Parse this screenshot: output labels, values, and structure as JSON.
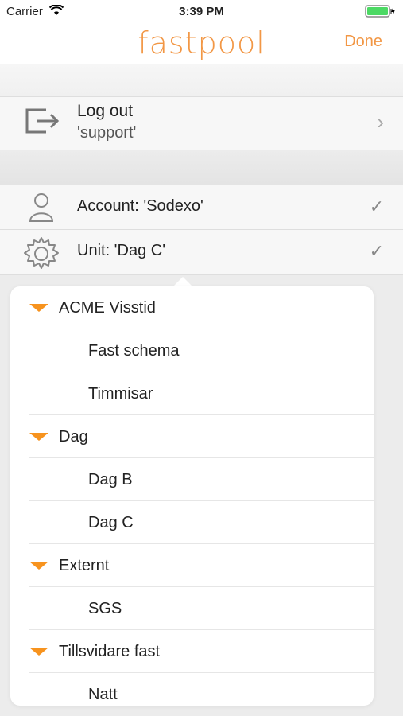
{
  "status": {
    "carrier": "Carrier",
    "time": "3:39 PM"
  },
  "nav": {
    "logo": "fastpool",
    "done": "Done"
  },
  "logout": {
    "title": "Log out",
    "user": "'support'"
  },
  "account": {
    "label": "Account: 'Sodexo'"
  },
  "unit": {
    "label": "Unit: 'Dag C'"
  },
  "colors": {
    "accent": "#f29745",
    "triangle": "#f7931e"
  },
  "list": [
    {
      "type": "group",
      "label": "ACME Visstid"
    },
    {
      "type": "child",
      "label": "Fast schema"
    },
    {
      "type": "child",
      "label": "Timmisar"
    },
    {
      "type": "group",
      "label": "Dag"
    },
    {
      "type": "child",
      "label": "Dag B"
    },
    {
      "type": "child",
      "label": "Dag C"
    },
    {
      "type": "group",
      "label": "Externt"
    },
    {
      "type": "child",
      "label": "SGS"
    },
    {
      "type": "group",
      "label": "Tillsvidare fast"
    },
    {
      "type": "child",
      "label": "Natt"
    }
  ]
}
